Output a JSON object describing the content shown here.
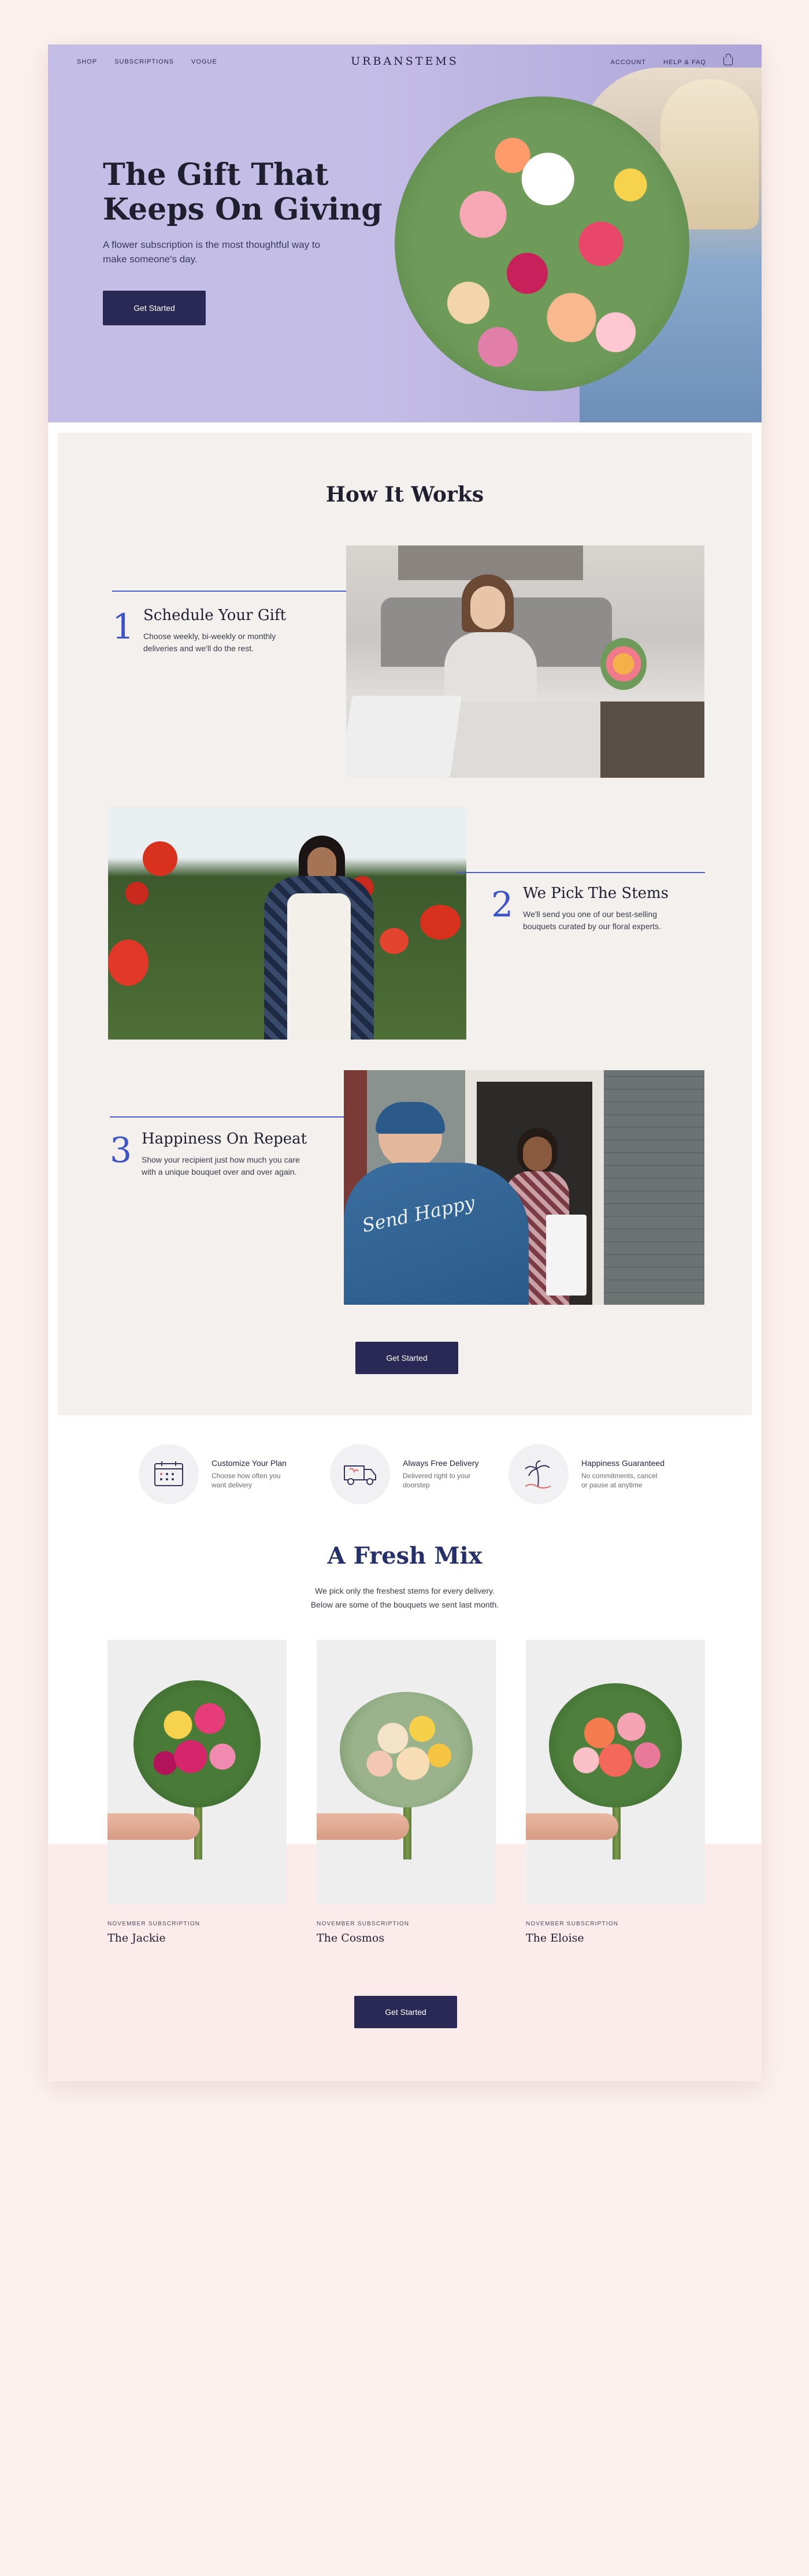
{
  "nav": {
    "left": [
      "SHOP",
      "SUBSCRIPTIONS",
      "VOGUE"
    ],
    "logo": "URBANSTEMS",
    "right": [
      "ACCOUNT",
      "HELP & FAQ"
    ]
  },
  "hero": {
    "title": "The Gift That Keeps On Giving",
    "subtitle": "A flower subscription is the most thoughtful way to make someone's day.",
    "button": "Get Started"
  },
  "how": {
    "title": "How It Works",
    "steps": [
      {
        "num": "1",
        "title": "Schedule Your Gift",
        "text": "Choose weekly, bi-weekly or monthly deliveries and we'll do the rest."
      },
      {
        "num": "2",
        "title": "We Pick The Stems",
        "text": "We'll send you one of our best-selling bouquets curated by our floral experts."
      },
      {
        "num": "3",
        "title": "Happiness On Repeat",
        "text": "Show your recipient just how much you care with a unique bouquet over and over again."
      }
    ],
    "button": "Get Started"
  },
  "features": [
    {
      "title": "Customize Your Plan",
      "desc": "Choose how often you want delivery",
      "icon": "calendar-icon"
    },
    {
      "title": "Always Free Delivery",
      "desc": "Delivered right to your doorstep",
      "icon": "truck-icon"
    },
    {
      "title": "Happiness Guaranteed",
      "desc": "No commitments, cancel or pause at anytime",
      "icon": "palm-tree-icon"
    }
  ],
  "mix": {
    "title": "A Fresh Mix",
    "subtitle_1": "We pick only the freshest stems for every delivery.",
    "subtitle_2": "Below are some of the bouquets we sent last month.",
    "cards": [
      {
        "caption": "NOVEMBER SUBSCRIPTION",
        "name": "The Jackie"
      },
      {
        "caption": "NOVEMBER SUBSCRIPTION",
        "name": "The Cosmos"
      },
      {
        "caption": "NOVEMBER SUBSCRIPTION",
        "name": "The Eloise"
      }
    ],
    "button": "Get Started"
  },
  "colors": {
    "hero_bg": "#c4bde6",
    "accent_blue": "#3d55c9",
    "button": "#2a2955",
    "page_bg": "#fcf1ed",
    "pink_band": "#fcebeb"
  }
}
